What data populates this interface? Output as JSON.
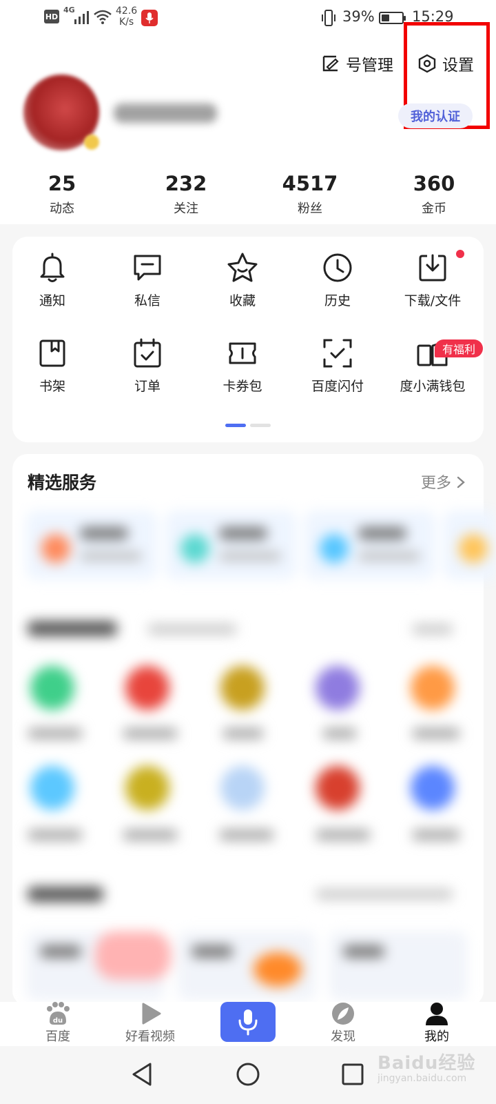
{
  "status_bar": {
    "hd": "HD",
    "network": "4G",
    "speed_value": "42.6",
    "speed_unit": "K/s",
    "battery": "39%",
    "time": "15:29"
  },
  "header": {
    "account_manage": "号管理",
    "settings": "设置",
    "certification": "我的认证"
  },
  "stats": [
    {
      "value": "25",
      "label": "动态"
    },
    {
      "value": "232",
      "label": "关注"
    },
    {
      "value": "4517",
      "label": "粉丝"
    },
    {
      "value": "360",
      "label": "金币"
    }
  ],
  "shortcuts": [
    {
      "label": "通知",
      "icon": "bell-icon"
    },
    {
      "label": "私信",
      "icon": "message-icon"
    },
    {
      "label": "收藏",
      "icon": "star-icon"
    },
    {
      "label": "历史",
      "icon": "clock-icon"
    },
    {
      "label": "下载/文件",
      "icon": "download-icon"
    },
    {
      "label": "书架",
      "icon": "bookshelf-icon"
    },
    {
      "label": "订单",
      "icon": "order-icon"
    },
    {
      "label": "卡券包",
      "icon": "coupon-icon"
    },
    {
      "label": "百度闪付",
      "icon": "scan-pay-icon"
    },
    {
      "label": "度小满钱包",
      "icon": "wallet-icon"
    }
  ],
  "welfare_badge": "有福利",
  "services": {
    "title": "精选服务",
    "more": "更多"
  },
  "tabs": [
    {
      "label": "百度",
      "icon": "baidu-paw-icon"
    },
    {
      "label": "好看视频",
      "icon": "video-play-icon"
    },
    {
      "label": "发现",
      "icon": "compass-icon"
    },
    {
      "label": "我的",
      "icon": "person-icon"
    }
  ],
  "watermark": {
    "brand": "Baidu经验",
    "url": "jingyan.baidu.com"
  },
  "colors": {
    "accent": "#4e6ef2",
    "highlight_box": "#f20000",
    "badge_red": "#f0304a"
  }
}
